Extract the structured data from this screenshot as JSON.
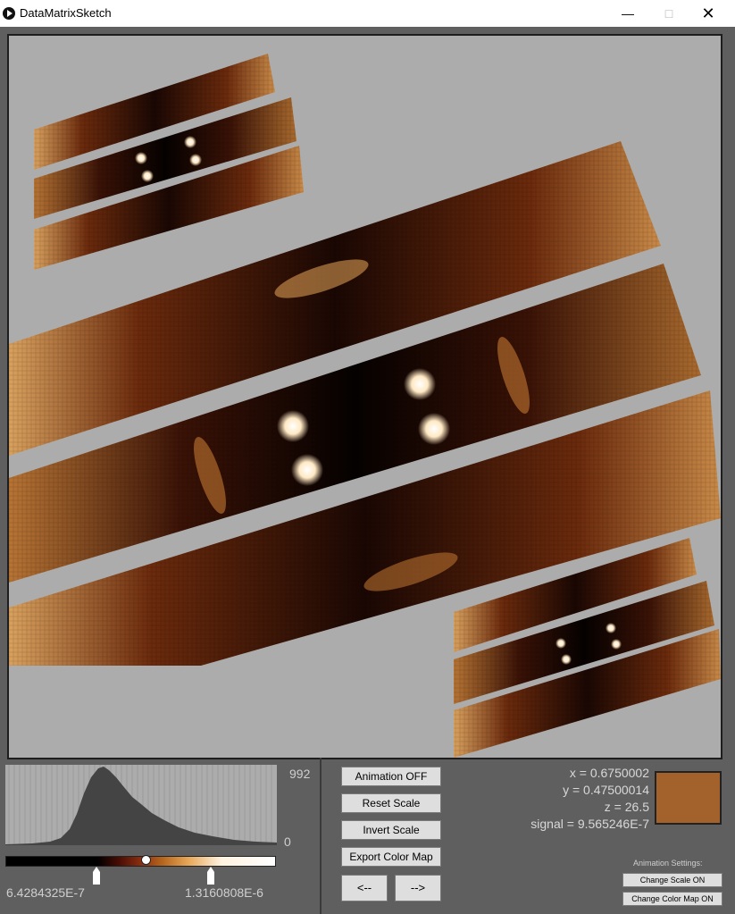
{
  "window": {
    "title": "DataMatrixSketch",
    "controls": {
      "minimize": "—",
      "maximize": "□",
      "close": "✕"
    }
  },
  "histogram": {
    "count_max": "992",
    "count_min": "0",
    "scale_min": "6.4284325E-7",
    "scale_max": "1.3160808E-6"
  },
  "buttons": {
    "animation": "Animation OFF",
    "reset_scale": "Reset Scale",
    "invert_scale": "Invert Scale",
    "export_color_map": "Export Color Map",
    "prev": "<--",
    "next": "-->"
  },
  "readout": {
    "x": "x = 0.6750002",
    "y": "y = 0.47500014",
    "z": "z = 26.5",
    "signal": "signal = 9.565246E-7"
  },
  "animation_settings": {
    "label": "Animation Settings:",
    "change_scale": "Change Scale ON",
    "change_color_map": "Change Color Map ON"
  },
  "colors": {
    "swatch": "#a3612c",
    "canvas_bg": "#acacac",
    "panel_bg": "#5f5f5f"
  }
}
